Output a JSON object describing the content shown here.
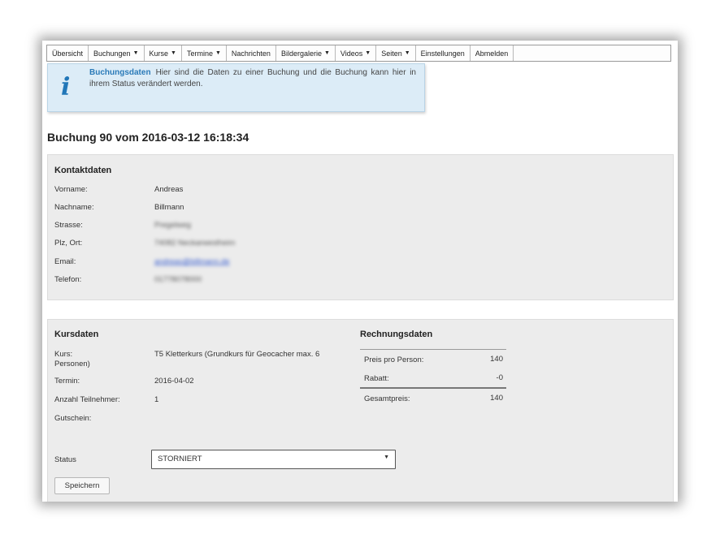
{
  "nav": {
    "items": [
      {
        "label": "Übersicht",
        "dropdown": false
      },
      {
        "label": "Buchungen",
        "dropdown": true
      },
      {
        "label": "Kurse",
        "dropdown": true
      },
      {
        "label": "Termine",
        "dropdown": true
      },
      {
        "label": "Nachrichten",
        "dropdown": false
      },
      {
        "label": "Bildergalerie",
        "dropdown": true
      },
      {
        "label": "Videos",
        "dropdown": true
      },
      {
        "label": "Seiten",
        "dropdown": true
      },
      {
        "label": "Einstellungen",
        "dropdown": false
      },
      {
        "label": "Abmelden",
        "dropdown": false
      }
    ],
    "caret": "▼"
  },
  "info": {
    "icon": "info-icon",
    "icon_glyph": "i",
    "title": "Buchungsdaten",
    "text": "Hier sind die Daten zu einer Buchung und die Buchung kann hier in ihrem Status verändert werden."
  },
  "booking": {
    "title": "Buchung 90 vom 2016-03-12 16:18:34"
  },
  "contact": {
    "heading": "Kontaktdaten",
    "fields": [
      {
        "label": "Vorname:",
        "value": "Andreas"
      },
      {
        "label": "Nachname:",
        "value": "Billmann"
      },
      {
        "label": "Strasse:",
        "value": "Pregelweg"
      },
      {
        "label": "Plz, Ort:",
        "value": "74082 Neckarwestheim"
      },
      {
        "label": "Email:",
        "value": "andreas@billmann.de"
      },
      {
        "label": "Telefon:",
        "value": "01778078000"
      }
    ]
  },
  "course": {
    "heading": "Kursdaten",
    "fields": [
      {
        "label": "Kurs:",
        "label2": "Personen)",
        "value": "T5 Kletterkurs (Grundkurs für Geocacher max. 6"
      },
      {
        "label": "Termin:",
        "value": "2016-04-02"
      },
      {
        "label": "Anzahl Teilnehmer:",
        "value": "1"
      },
      {
        "label": "Gutschein:",
        "value": ""
      }
    ],
    "status_label": "Status",
    "status_value": "STORNIERT",
    "save_label": "Speichern"
  },
  "invoice": {
    "heading": "Rechnungsdaten",
    "rows": [
      {
        "label": "Preis pro Person:",
        "value": "140"
      },
      {
        "label": "Rabatt:",
        "value": "-0"
      },
      {
        "label": "Gesamtpreis:",
        "value": "140"
      }
    ]
  },
  "colors": {
    "info_bg": "#dcecf7",
    "info_title": "#2a7ab8",
    "panel_bg": "#ececec"
  }
}
